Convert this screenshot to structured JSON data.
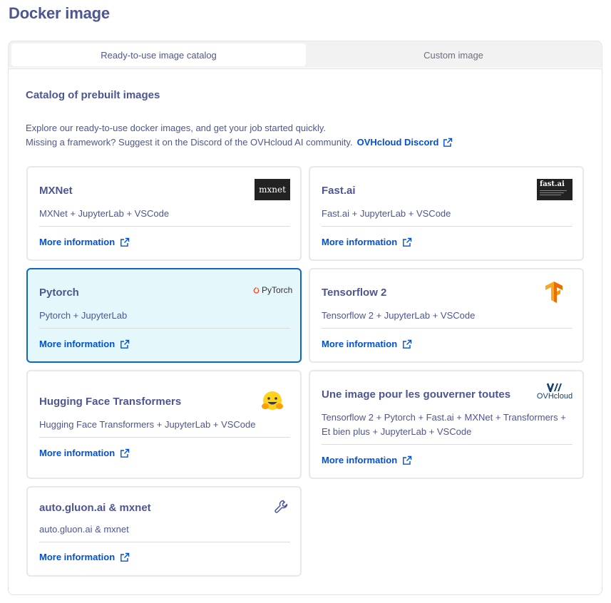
{
  "page": {
    "title": "Docker image"
  },
  "tabs": [
    {
      "label": "Ready-to-use image catalog",
      "active": true
    },
    {
      "label": "Custom image",
      "active": false
    }
  ],
  "catalog": {
    "heading": "Catalog of prebuilt images",
    "intro_line1": "Explore our ready-to-use docker images, and get your job started quickly.",
    "intro_line2": "Missing a framework? Suggest it on the Discord of the OVHcloud AI community.",
    "discord_link": "OVHcloud Discord"
  },
  "cards": [
    {
      "title": "MXNet",
      "description": "MXNet + JupyterLab + VSCode",
      "link": "More information",
      "logo_text": "mxnet",
      "selected": false
    },
    {
      "title": "Fast.ai",
      "description": "Fast.ai + JupyterLab + VSCode",
      "link": "More information",
      "logo_text": "fast.ai",
      "selected": false
    },
    {
      "title": "Pytorch",
      "description": "Pytorch + JupyterLab",
      "link": "More information",
      "logo_text": "PyTorch",
      "selected": true
    },
    {
      "title": "Tensorflow 2",
      "description": "Tensorflow 2 + JupyterLab + VSCode",
      "link": "More information",
      "selected": false
    },
    {
      "title": "Hugging Face Transformers",
      "description": "Hugging Face Transformers + JupyterLab + VSCode",
      "link": "More information",
      "selected": false
    },
    {
      "title": "Une image pour les gouverner toutes",
      "description": "Tensorflow 2 + Pytorch + Fast.ai + MXNet + Transformers + Et bien plus + JupyterLab + VSCode",
      "link": "More information",
      "logo_text": "OVHcloud",
      "selected": false
    },
    {
      "title": "auto.gluon.ai & mxnet",
      "description": "auto.gluon.ai & mxnet",
      "link": "More information",
      "selected": false
    }
  ],
  "colors": {
    "title": "#4d5693",
    "link": "#0050d7",
    "selected_bg": "#e4f8fc",
    "selected_border": "#1166c4"
  },
  "icons": {
    "external_link": "external-link-icon",
    "wrench": "wrench-icon",
    "tensorflow": "tensorflow-logo-icon",
    "huggingface": "hugging-face-emoji-icon"
  }
}
